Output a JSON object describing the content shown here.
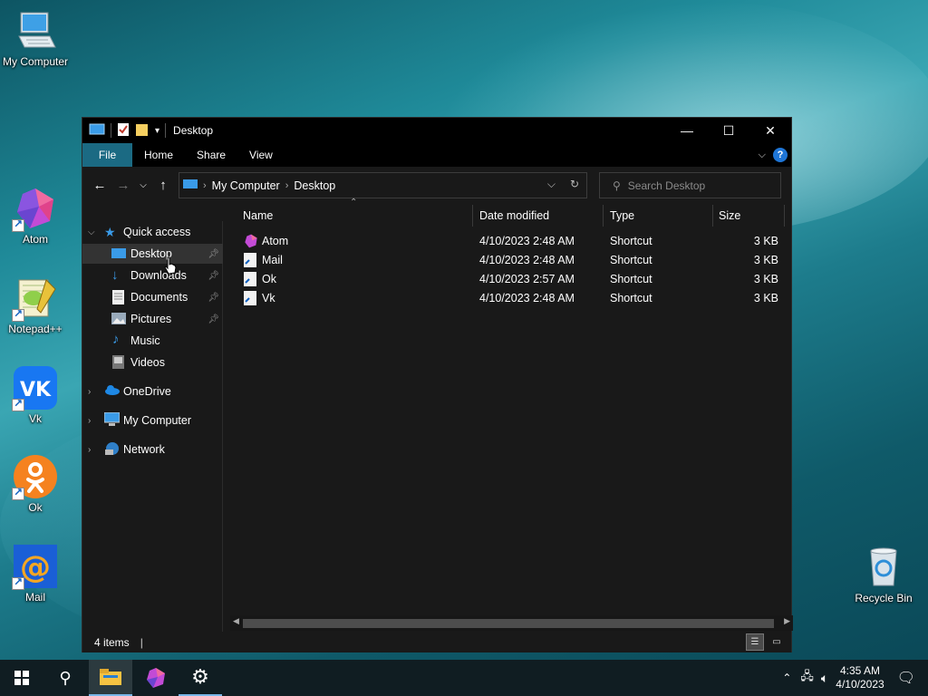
{
  "desktop": {
    "icons": [
      {
        "label": "My Computer",
        "icon": "computer-icon"
      },
      {
        "label": "Atom",
        "icon": "atom-icon"
      },
      {
        "label": "Notepad++",
        "icon": "notepadpp-icon"
      },
      {
        "label": "Vk",
        "icon": "vk-icon"
      },
      {
        "label": "Ok",
        "icon": "ok-icon"
      },
      {
        "label": "Mail",
        "icon": "mail-icon"
      },
      {
        "label": "Recycle Bin",
        "icon": "recycle-bin-icon"
      }
    ]
  },
  "window": {
    "title": "Desktop",
    "controls": {
      "minimize": "—",
      "maximize": "☐",
      "close": "✕"
    },
    "ribbon_tabs": [
      "File",
      "Home",
      "Share",
      "View"
    ],
    "address": {
      "crumbs": [
        "My Computer",
        "Desktop"
      ],
      "separator": "›"
    },
    "search": {
      "placeholder": "Search Desktop"
    },
    "nav": {
      "quick_access": "Quick access",
      "items": [
        "Desktop",
        "Downloads",
        "Documents",
        "Pictures",
        "Music",
        "Videos"
      ],
      "onedrive": "OneDrive",
      "my_computer": "My Computer",
      "network": "Network"
    },
    "columns": [
      "Name",
      "Date modified",
      "Type",
      "Size"
    ],
    "files": [
      {
        "name": "Atom",
        "date": "4/10/2023 2:48 AM",
        "type": "Shortcut",
        "size": "3 KB"
      },
      {
        "name": "Mail",
        "date": "4/10/2023 2:48 AM",
        "type": "Shortcut",
        "size": "3 KB"
      },
      {
        "name": "Ok",
        "date": "4/10/2023 2:57 AM",
        "type": "Shortcut",
        "size": "3 KB"
      },
      {
        "name": "Vk",
        "date": "4/10/2023 2:48 AM",
        "type": "Shortcut",
        "size": "3 KB"
      }
    ],
    "status": {
      "items": "4 items"
    }
  },
  "taskbar": {
    "time": "4:35 AM",
    "date": "4/10/2023"
  },
  "colors": {
    "file_tab": "#1b6a83",
    "selection": "#333333",
    "accent": "#78b6e8"
  }
}
